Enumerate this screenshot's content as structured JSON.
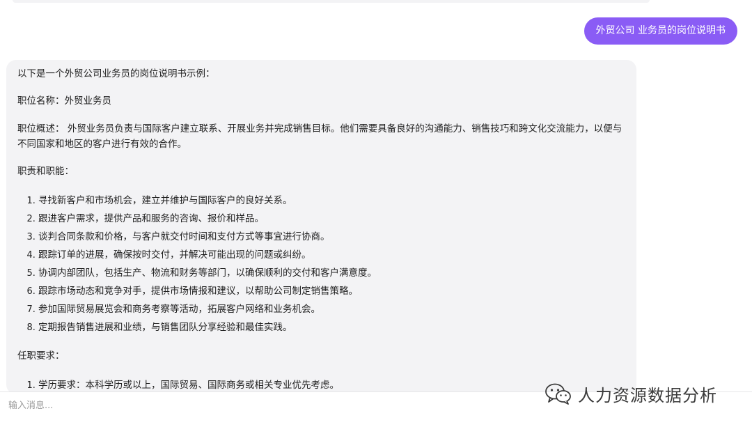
{
  "user_message": "外贸公司  业务员的岗位说明书",
  "assistant": {
    "intro": "以下是一个外贸公司业务员的岗位说明书示例：",
    "job_title": "职位名称：外贸业务员",
    "overview": "职位概述： 外贸业务员负责与国际客户建立联系、开展业务并完成销售目标。他们需要具备良好的沟通能力、销售技巧和跨文化交流能力，以便与不同国家和地区的客户进行有效的合作。",
    "duties_heading": "职责和职能：",
    "duties": [
      "寻找新客户和市场机会，建立并维护与国际客户的良好关系。",
      "跟进客户需求，提供产品和服务的咨询、报价和样品。",
      "谈判合同条款和价格，与客户就交付时间和支付方式等事宜进行协商。",
      "跟踪订单的进展，确保按时交付，并解决可能出现的问题或纠纷。",
      "协调内部团队，包括生产、物流和财务等部门，以确保顺利的交付和客户满意度。",
      "跟踪市场动态和竞争对手，提供市场情报和建议，以帮助公司制定销售策略。",
      "参加国际贸易展览会和商务考察等活动，拓展客户网络和业务机会。",
      "定期报告销售进展和业绩，与销售团队分享经验和最佳实践。"
    ],
    "requirements_heading": "任职要求：",
    "requirements": [
      "学历要求：本科学历或以上，国际贸易、国际商务或相关专业优先考虑。"
    ]
  },
  "input": {
    "placeholder": "输入消息..."
  },
  "watermark": {
    "text": "人力资源数据分析",
    "icon": "wechat-logo-icon"
  },
  "colors": {
    "user_bubble": "#8a5cf5",
    "assistant_bubble": "#f3f3f5"
  }
}
